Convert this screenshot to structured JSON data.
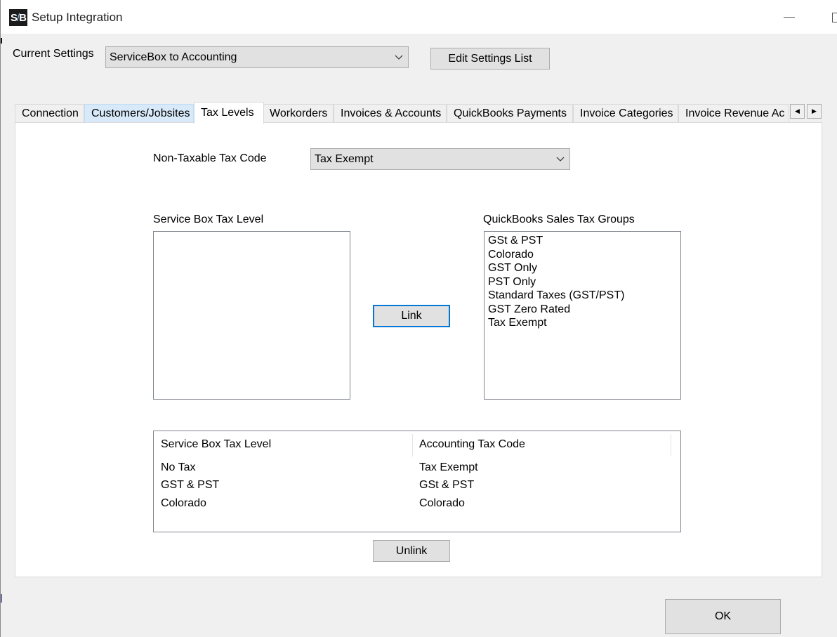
{
  "window": {
    "title": "Setup Integration",
    "icon_text": [
      "S",
      "/",
      "B"
    ]
  },
  "settings": {
    "label": "Current Settings",
    "selected": "ServiceBox to Accounting",
    "edit_button": "Edit Settings List"
  },
  "tabs": [
    {
      "label": "Connection"
    },
    {
      "label": "Customers/Jobsites"
    },
    {
      "label": "Tax Levels"
    },
    {
      "label": "Workorders"
    },
    {
      "label": "Invoices & Accounts"
    },
    {
      "label": "QuickBooks Payments"
    },
    {
      "label": "Invoice Categories"
    },
    {
      "label": "Invoice Revenue Ac"
    }
  ],
  "active_tab": "Tax Levels",
  "tax_levels": {
    "non_taxable_label": "Non-Taxable Tax Code",
    "non_taxable_selected": "Tax Exempt",
    "sb_list_label": "Service Box Tax Level",
    "sb_list_items": [],
    "qb_list_label": "QuickBooks Sales Tax Groups",
    "qb_list_items": [
      "GSt & PST",
      "Colorado",
      "GST Only",
      "PST Only",
      "Standard Taxes (GST/PST)",
      "GST Zero Rated",
      "Tax Exempt"
    ],
    "link_button": "Link",
    "unlink_button": "Unlink",
    "mapping_columns": [
      "Service Box Tax Level",
      "Accounting Tax Code"
    ],
    "mapping_rows": [
      [
        "No Tax",
        "Tax Exempt"
      ],
      [
        "GST & PST",
        "GSt & PST"
      ],
      [
        "Colorado",
        "Colorado"
      ]
    ]
  },
  "footer": {
    "ok_button": "OK"
  },
  "colors": {
    "accent": "#0078d7",
    "tab_hover": "#d8eaf9",
    "panel_bg": "#ffffff",
    "window_bg": "#f0f0f0"
  }
}
